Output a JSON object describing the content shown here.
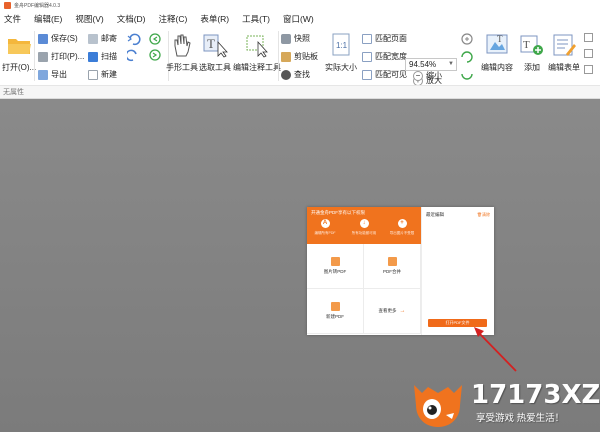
{
  "window": {
    "title": "金舟PDF编辑器4.0.3"
  },
  "menu": [
    "文件",
    "编辑(E)",
    "视图(V)",
    "文档(D)",
    "注释(C)",
    "表单(R)",
    "工具(T)",
    "窗口(W)"
  ],
  "ribbon": {
    "open": "打开(O)...",
    "save": "保存(S)",
    "print": "打印(P)...",
    "export": "导出",
    "email": "邮寄",
    "scan": "扫描",
    "new": "新建",
    "hand_tool": "手形工具",
    "select_tool": "选取工具",
    "edit_annot_tool": "编辑注释工具",
    "snapshot": "快照",
    "clipboard": "剪贴板",
    "find": "查找",
    "actual_size": "实际大小",
    "fit_page": "匹配页面",
    "fit_width": "匹配宽度",
    "fit_visible": "匹配可见",
    "zoom_value": "94.54%",
    "zoom_in": "放大",
    "zoom_out": "缩小",
    "edit_content": "编辑内容",
    "add": "添加",
    "edit_form": "编辑表单"
  },
  "attr_bar": "无属性",
  "start_panel": {
    "welcome": "开通金舟PDF享有以下权限",
    "quick_actions": [
      "编辑所有PDF",
      "所有功能都可用",
      "导出图片不受限"
    ],
    "tiles": {
      "image_to_pdf": "图片转PDF",
      "merge_pdf": "PDF合并",
      "new_pdf": "新建PDF",
      "more": "查看更多"
    },
    "recent_title": "最近编辑",
    "clear_recent": "清除",
    "open_button": "打开PDF文件"
  },
  "watermark": {
    "brand": "17173XZ",
    "slogan": "享受游戏 热爱生活！"
  },
  "colors": {
    "accent": "#f0731e",
    "workspace": "#7b7b7b",
    "annotation_arrow": "#d32121"
  }
}
